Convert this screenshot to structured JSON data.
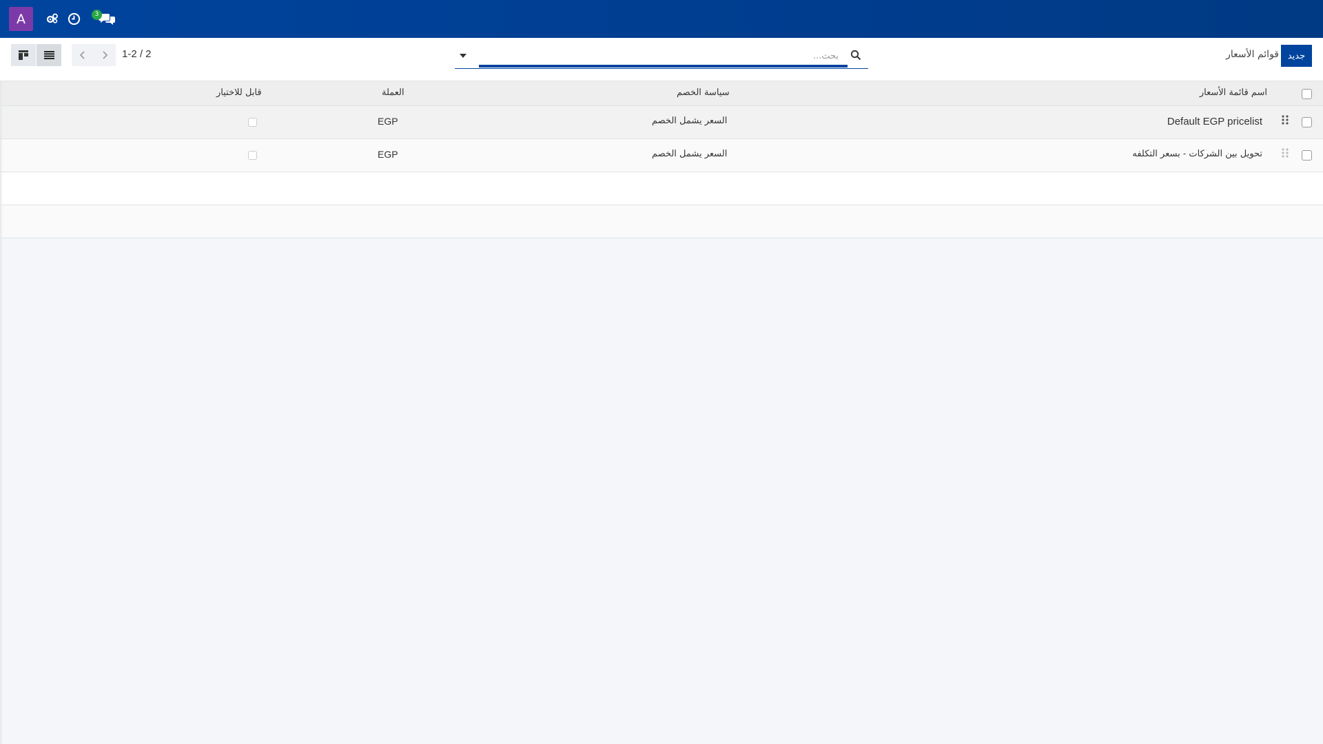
{
  "navbar": {
    "avatar_letter": "A",
    "icons": [
      "gears-icon",
      "clock-icon",
      "chat-icon"
    ],
    "chat_badge_count": "3",
    "bg_color": "#00449e"
  },
  "control_panel": {
    "new_button_label": "جديد",
    "breadcrumb": "قوائم الأسعار",
    "search_placeholder": "بحث...",
    "pager_value": "1-2 / 2",
    "view_modes": [
      "kanban",
      "list"
    ]
  },
  "table": {
    "columns": [
      "اسم قائمة الأسعار",
      "سياسة الخصم",
      "العملة",
      "قابل للاختيار"
    ],
    "rows": [
      {
        "name": "Default EGP pricelist",
        "discount_policy": "السعر يشمل الخصم",
        "currency": "EGP",
        "selectable": false
      },
      {
        "name": "تحويل بين الشركات - بسعر التكلفه",
        "discount_policy": "السعر يشمل الخصم",
        "currency": "EGP",
        "selectable": false
      }
    ]
  }
}
